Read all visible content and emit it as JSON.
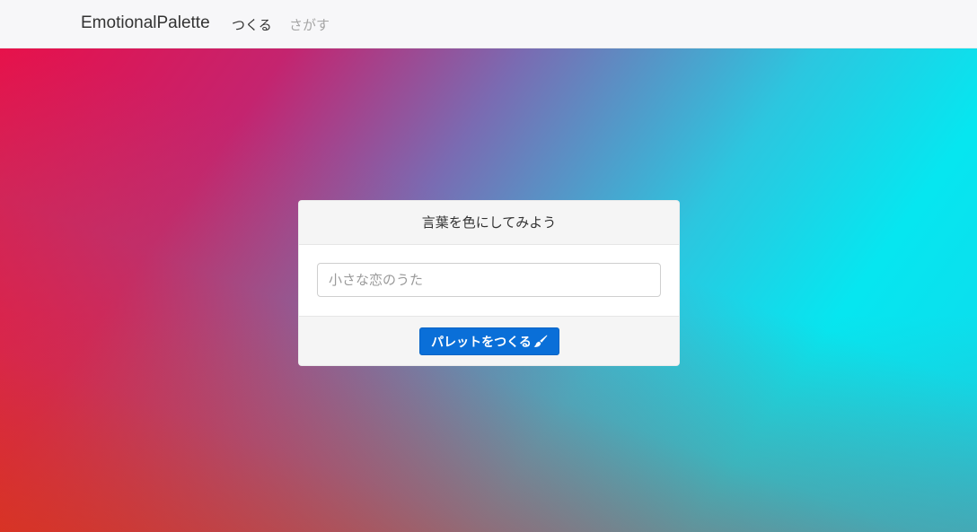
{
  "navbar": {
    "brand": "EmotionalPalette",
    "links": [
      {
        "label": "つくる",
        "active": true
      },
      {
        "label": "さがす",
        "active": false
      }
    ]
  },
  "card": {
    "header": "言葉を色にしてみよう",
    "input": {
      "placeholder": "小さな恋のうた",
      "value": ""
    },
    "submit_label": "パレットをつくる",
    "submit_icon": "paint-brush-icon"
  },
  "colors": {
    "primary": "#0a6fd8",
    "gradient_red": "#f4210e",
    "gradient_pink": "#e8104a",
    "gradient_cyan": "#06e6f0"
  }
}
